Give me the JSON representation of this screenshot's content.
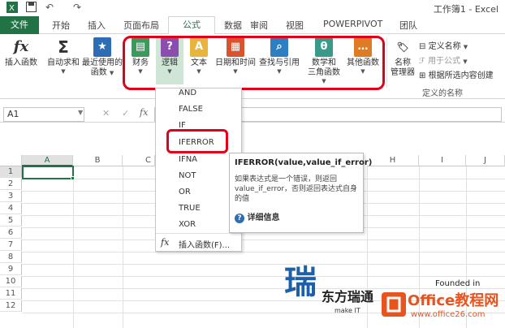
{
  "title_bar": {
    "title": "工作簿1 - Excel"
  },
  "tabs": [
    "文件",
    "开始",
    "插入",
    "页面布局",
    "公式",
    "数据",
    "审阅",
    "视图",
    "POWERPIVOT",
    "团队"
  ],
  "ribbon": {
    "insert_function": "插入函数",
    "autosum": "自动求和",
    "recent_1": "最近使用的",
    "recent_2": "函数",
    "finance": "财务",
    "logic": "逻辑",
    "text": "文本",
    "datetime": "日期和时间",
    "lookup": "查找与引用",
    "math_1": "数学和",
    "math_2": "三角函数",
    "other": "其他函数",
    "name_mgr_1": "名称",
    "name_mgr_2": "管理器",
    "define_name": "定义名称",
    "use_in_formula": "用于公式",
    "create_from_sel": "根据所选内容创建",
    "group_label": "定义的名称"
  },
  "formula_bar": {
    "name_box": "A1",
    "fx": "fx"
  },
  "columns": [
    "A",
    "B",
    "C",
    "H",
    "I",
    "J"
  ],
  "rows": [
    "1",
    "2",
    "3",
    "4",
    "5",
    "6",
    "7",
    "8",
    "9",
    "10",
    "11",
    "12"
  ],
  "dropdown": {
    "items": [
      "AND",
      "FALSE",
      "IF",
      "IFERROR",
      "IFNA",
      "NOT",
      "OR",
      "TRUE",
      "XOR"
    ],
    "insert_function": "插入函数(F)..."
  },
  "tooltip": {
    "title": "IFERROR(value,value_if_error)",
    "desc": "如果表达式是一个错误，则返回 value_if_error，否则返回表达式自身的值",
    "more": "详细信息"
  },
  "watermark": {
    "founded": "Founded in",
    "make_it": "make IT",
    "brand": "东方瑞通",
    "site_1": "Office教程网",
    "site_2": "www.office26.com"
  }
}
